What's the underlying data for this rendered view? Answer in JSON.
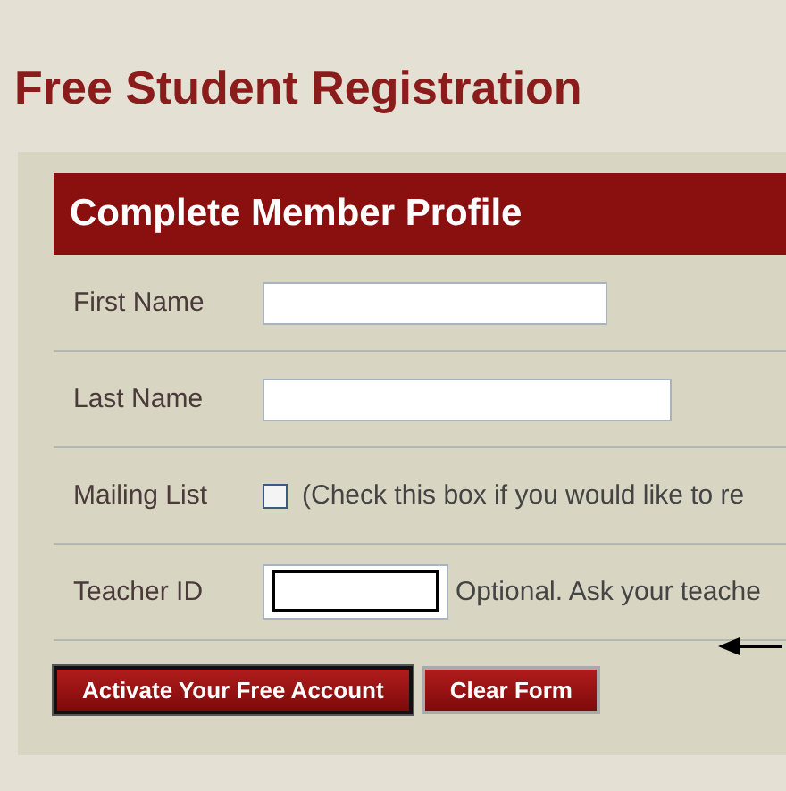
{
  "page_title": "Free Student Registration",
  "form": {
    "title": "Complete Member Profile",
    "rows": [
      {
        "kind": "short_text",
        "label": "First Name"
      },
      {
        "kind": "long_text",
        "label": "Last Name"
      },
      {
        "kind": "checkbox",
        "label": "Mailing List",
        "checked": false,
        "note": "(Check this box if you would like to re"
      },
      {
        "kind": "focused",
        "label": "Teacher ID",
        "note": "Optional. Ask your teache"
      }
    ],
    "buttons": [
      {
        "label": "Activate Your Free Account",
        "focused": true
      },
      {
        "label": "Clear Form",
        "focused": false
      }
    ]
  }
}
